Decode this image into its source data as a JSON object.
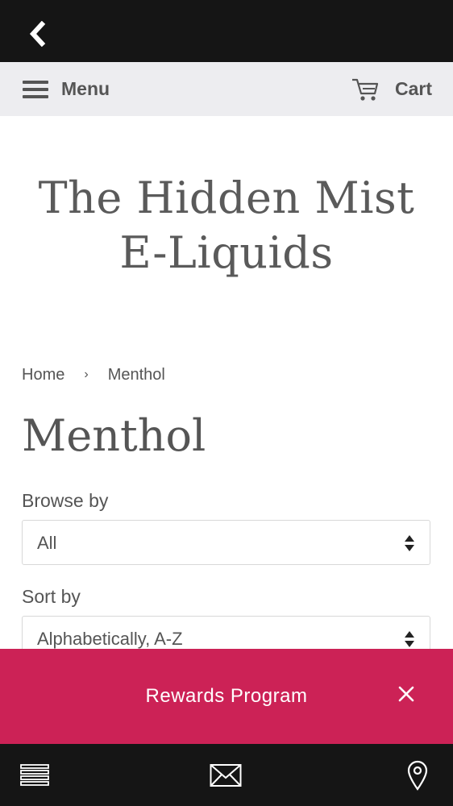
{
  "topbar": {
    "back_icon": "chevron-left-icon"
  },
  "navbar": {
    "menu_label": "Menu",
    "menu_icon": "hamburger-icon",
    "cart_label": "Cart",
    "cart_icon": "shopping-cart-icon"
  },
  "site": {
    "title_line1": "The Hidden Mist",
    "title_line2": "E-Liquids"
  },
  "breadcrumb": {
    "home": "Home",
    "separator": "›",
    "current": "Menthol"
  },
  "collection": {
    "title": "Menthol"
  },
  "filters": {
    "browse_label": "Browse by",
    "browse_value": "All",
    "sort_label": "Sort by",
    "sort_value": "Alphabetically, A-Z"
  },
  "rewards": {
    "label": "Rewards Program",
    "close_icon": "close-icon",
    "color": "#cc2256"
  },
  "bottom_nav": {
    "items": [
      {
        "icon": "list-icon"
      },
      {
        "icon": "mail-icon"
      },
      {
        "icon": "location-pin-icon"
      }
    ]
  }
}
